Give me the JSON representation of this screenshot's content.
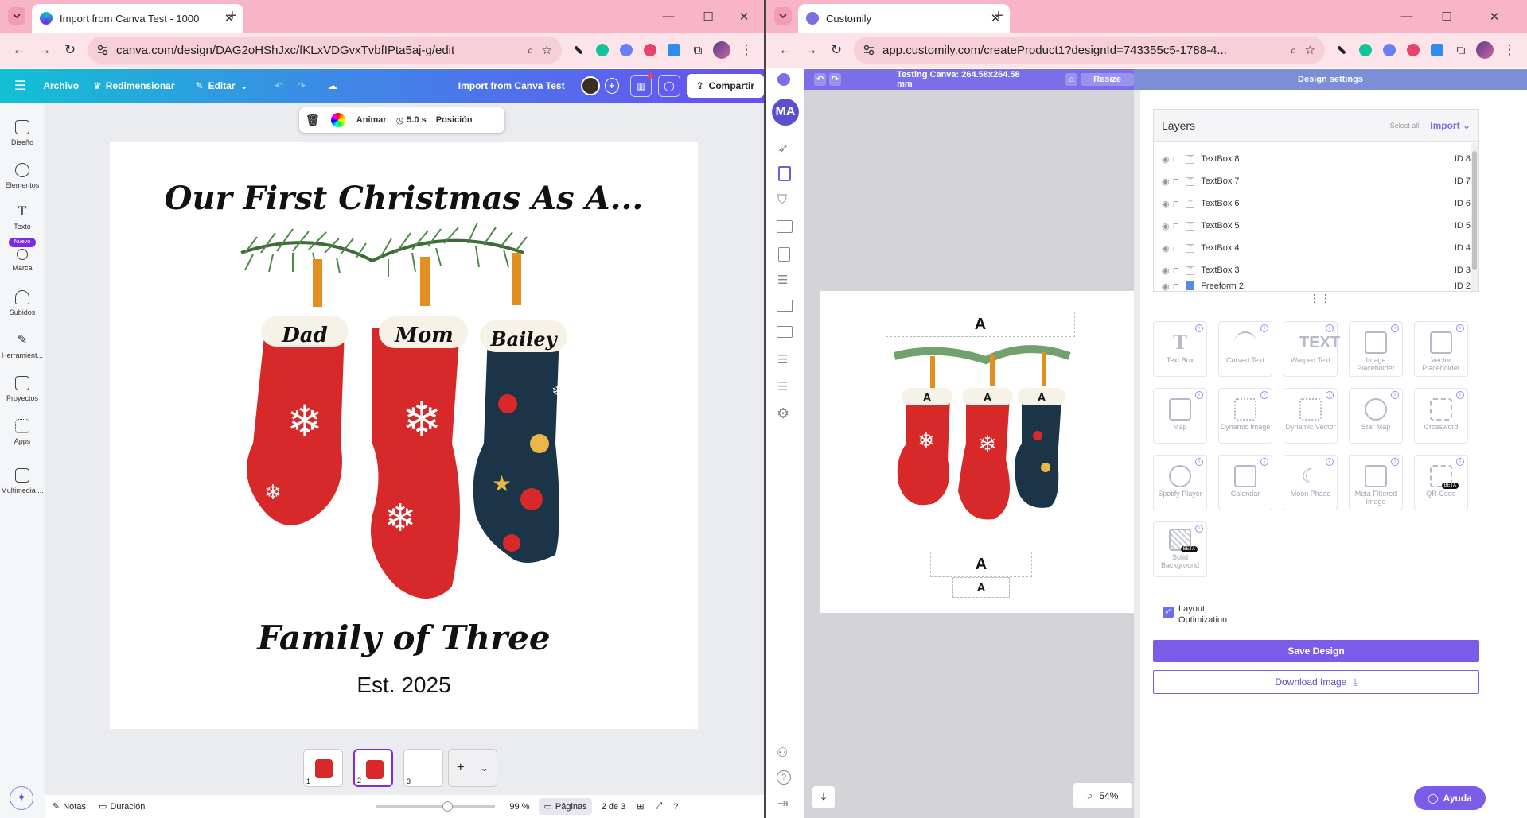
{
  "left_window": {
    "tab_title": "Import from Canva Test - 1000",
    "url": "canva.com/design/DAG2oHShJxc/fKLxVDGvxTvbfIPta5aj-g/edit",
    "topbar": {
      "archivo": "Archivo",
      "redimensionar": "Redimensionar",
      "editar": "Editar",
      "doc_title": "Import from Canva Test",
      "share": "Compartir"
    },
    "side_items": [
      "Diseño",
      "Elementos",
      "Texto",
      "Marca",
      "Subidos",
      "Herramient...",
      "Proyectos",
      "Apps",
      "Multimedia ..."
    ],
    "nuevo_badge": "Nuevo",
    "context_bar": {
      "animar": "Animar",
      "duration": "5.0 s",
      "posicion": "Posición"
    },
    "design": {
      "title": "Our First Christmas As A...",
      "names": [
        "Dad",
        "Mom",
        "Bailey"
      ],
      "subtitle": "Family of Three",
      "est": "Est. 2025"
    },
    "thumbs": [
      "1",
      "2",
      "3"
    ],
    "bottom": {
      "notas": "Notas",
      "duracion": "Duración",
      "zoom": "99 %",
      "paginas": "Páginas",
      "page_count": "2 de 3"
    }
  },
  "right_window": {
    "tab_title": "Customily",
    "url": "app.customily.com/createProduct1?designId=743355c5-1788-4...",
    "header": {
      "testing": "Testing Canva: 264.58x264.58 mm",
      "resize": "Resize",
      "design_settings": "Design settings"
    },
    "avatar_initials": "MA",
    "layers": {
      "title": "Layers",
      "select_all": "Select all",
      "import": "Import",
      "rows": [
        {
          "name": "TextBox 8",
          "id": "ID 8"
        },
        {
          "name": "TextBox 7",
          "id": "ID 7"
        },
        {
          "name": "TextBox 6",
          "id": "ID 6"
        },
        {
          "name": "TextBox 5",
          "id": "ID 5"
        },
        {
          "name": "TextBox 4",
          "id": "ID 4"
        },
        {
          "name": "TextBox 3",
          "id": "ID 3"
        },
        {
          "name": "Freeform 2",
          "id": "ID 2"
        }
      ]
    },
    "tools": [
      "Text Box",
      "Curved Text",
      "Warped Text",
      "Image Placeholder",
      "Vector Placeholder",
      "Map",
      "Dynamic Image",
      "Dynamic Vector",
      "Star Map",
      "Crossword",
      "Spotify Player",
      "Calendar",
      "Moon Phase",
      "Meta Filtered Image",
      "QR Code",
      "Solid Background"
    ],
    "beta": "BETA",
    "layout_optimization": "Layout Optimization",
    "save_design": "Save Design",
    "download_image": "Download Image",
    "zoom": "54%",
    "help": "Ayuda",
    "placeholder_letter": "A"
  },
  "colors": {
    "canva_purple": "#7d2ae8",
    "customily_purple": "#7b6fe8",
    "tab_pink": "#f8b5c7"
  }
}
